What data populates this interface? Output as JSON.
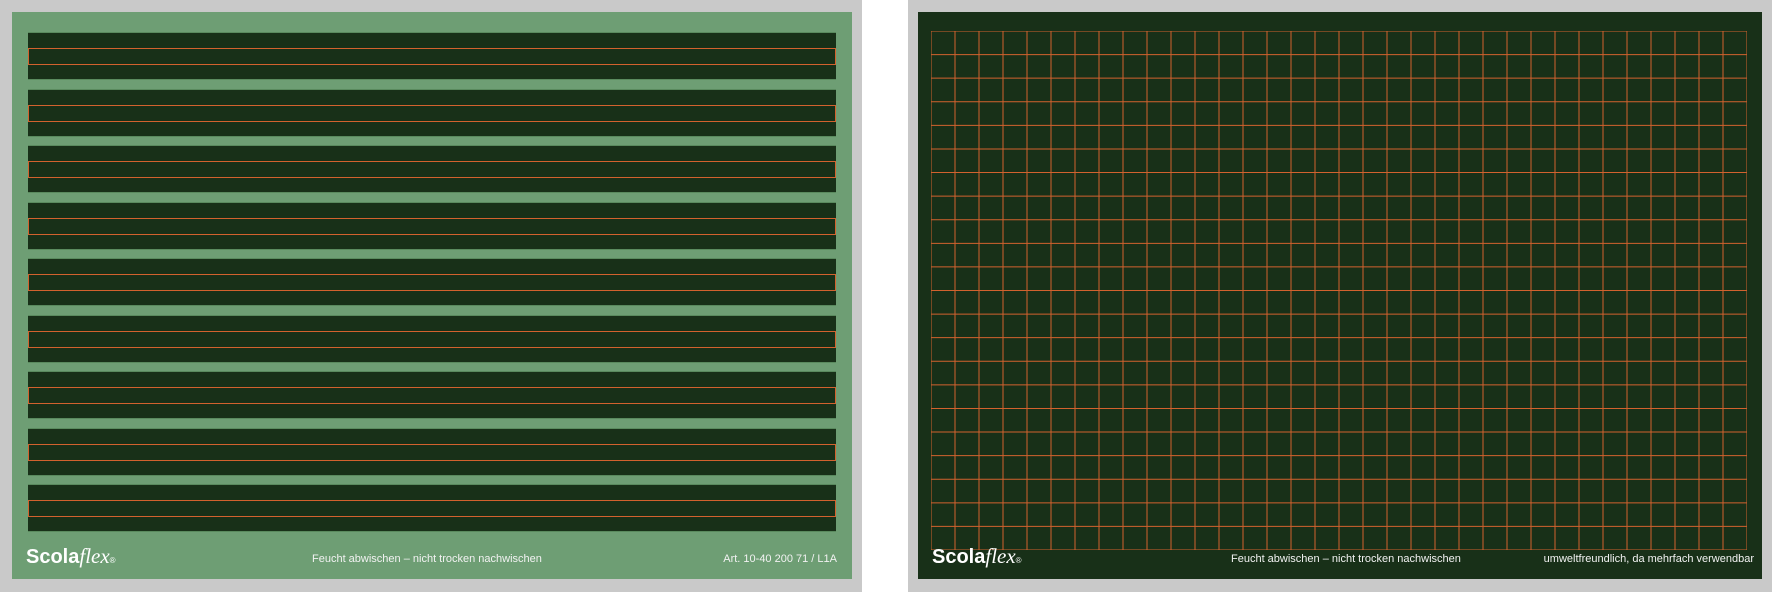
{
  "left_board": {
    "logo": {
      "bold": "Scola",
      "italic": "flex",
      "mark": "®"
    },
    "footer_mid": "Feucht abwischen – nicht trocken nachwischen",
    "footer_right": "Art. 10-40 200 71 / L1A",
    "strip_count": 9
  },
  "right_board": {
    "logo": {
      "bold": "Scola",
      "italic": "flex",
      "mark": "®"
    },
    "footer_mid": "Feucht abwischen – nicht trocken nachwischen",
    "footer_right": "umweltfreundlich, da mehrfach verwendbar",
    "grid": {
      "columns": 34,
      "rows": 22
    }
  },
  "colors": {
    "frame": "#c9c9c9",
    "board_green": "#183018",
    "margin_green": "#6e9e74",
    "line_orange": "#d2622e"
  }
}
